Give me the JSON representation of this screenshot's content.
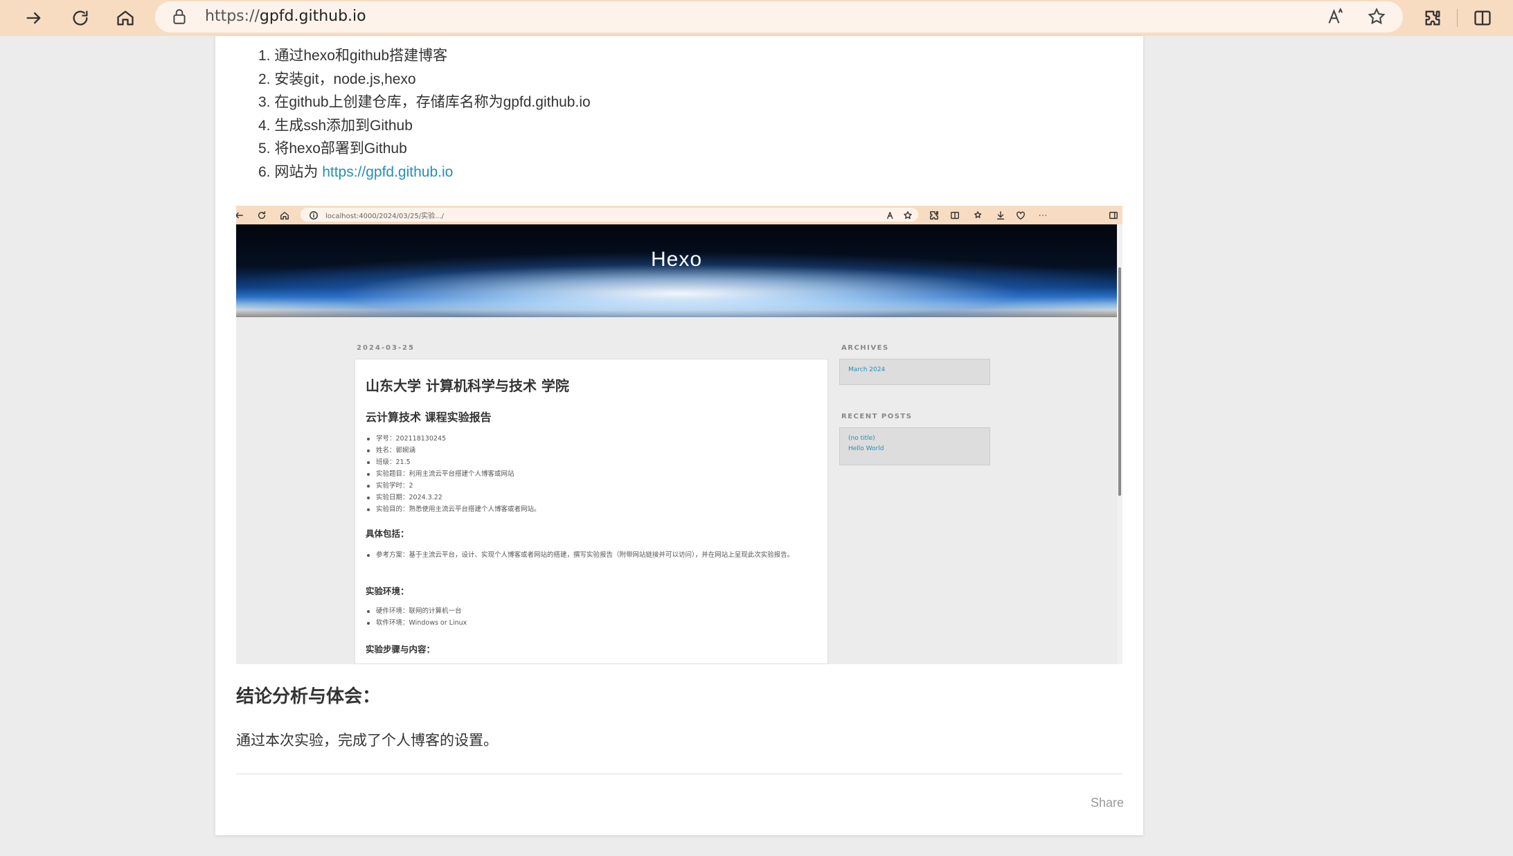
{
  "browser": {
    "url_protocol": "https://",
    "url_host": "gpfd.github.io"
  },
  "steps": [
    "1. 通过hexo和github搭建博客",
    "2. 安装git，node.js,hexo",
    "3. 在github上创建仓库，存储库名称为gpfd.github.io",
    "4. 生成ssh添加到Github",
    "5. 将hexo部署到Github"
  ],
  "step6": {
    "prefix": "6. 网站为 ",
    "link": "https://gpfd.github.io"
  },
  "screenshot": {
    "url_host": "localhost",
    "url_path": ":4000/2024/03/25/实验.../",
    "site_title": "Hexo",
    "post_date": "2024-03-25",
    "post_h1": "山东大学 计算机科学与技术 学院",
    "post_h2": "云计算技术 课程实验报告",
    "info_items": [
      "学号：202118130245",
      "姓名：郭婉涵",
      "班级：21.5",
      "实验题目：利用主流云平台搭建个人博客或网站",
      "实验学时：2",
      "实验日期：2024.3.22",
      "实验目的：熟悉使用主流云平台搭建个人博客或者网站。"
    ],
    "section1_title": "具体包括：",
    "section1_items": [
      "参考方案：基于主流云平台，设计、实现个人博客或者网站的搭建，撰写实验报告（附带网站链接并可以访问），并在网站上呈现此次实验报告。"
    ],
    "section2_title": "实验环境：",
    "section2_items": [
      "硬件环境：联网的计算机一台",
      "软件环境：Windows or Linux"
    ],
    "section3_title": "实验步骤与内容：",
    "archives_heading": "ARCHIVES",
    "archives_items": [
      "March 2024"
    ],
    "recent_heading": "RECENT POSTS",
    "recent_items": [
      "(no title)",
      "Hello World"
    ]
  },
  "conclusion": {
    "title": "结论分析与体会：",
    "text": "通过本次实验，完成了个人博客的设置。"
  },
  "share_label": "Share",
  "icons": [
    "forward-icon",
    "refresh-icon",
    "home-icon",
    "lock-icon",
    "read-aloud-icon",
    "favorite-star-icon",
    "extensions-icon",
    "split-screen-icon"
  ]
}
